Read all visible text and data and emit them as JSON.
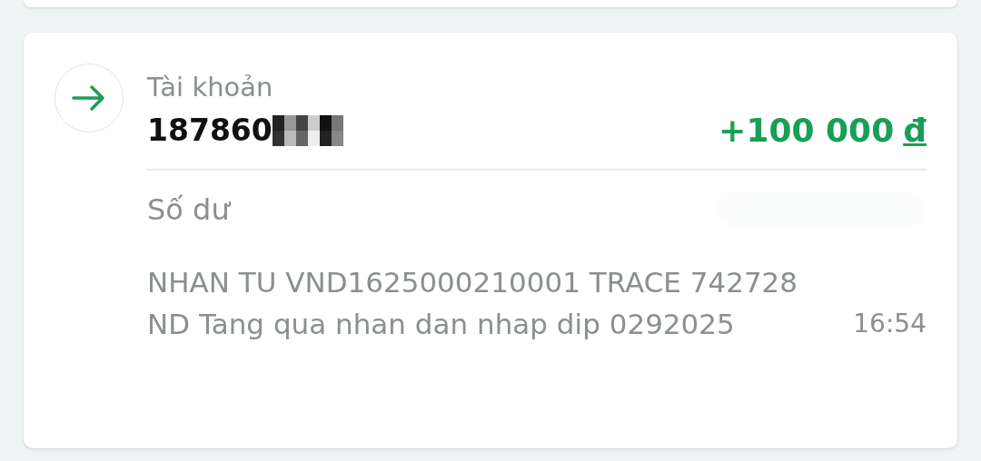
{
  "transaction": {
    "account_label": "Tài khoản",
    "account_number": "187860",
    "amount": "+100 000",
    "currency": "đ",
    "balance_label": "Số dư",
    "description": "NHAN TU VND1625000210001 TRACE 742728 ND Tang qua nhan dan nhap dip 0292025",
    "time": "16:54"
  }
}
